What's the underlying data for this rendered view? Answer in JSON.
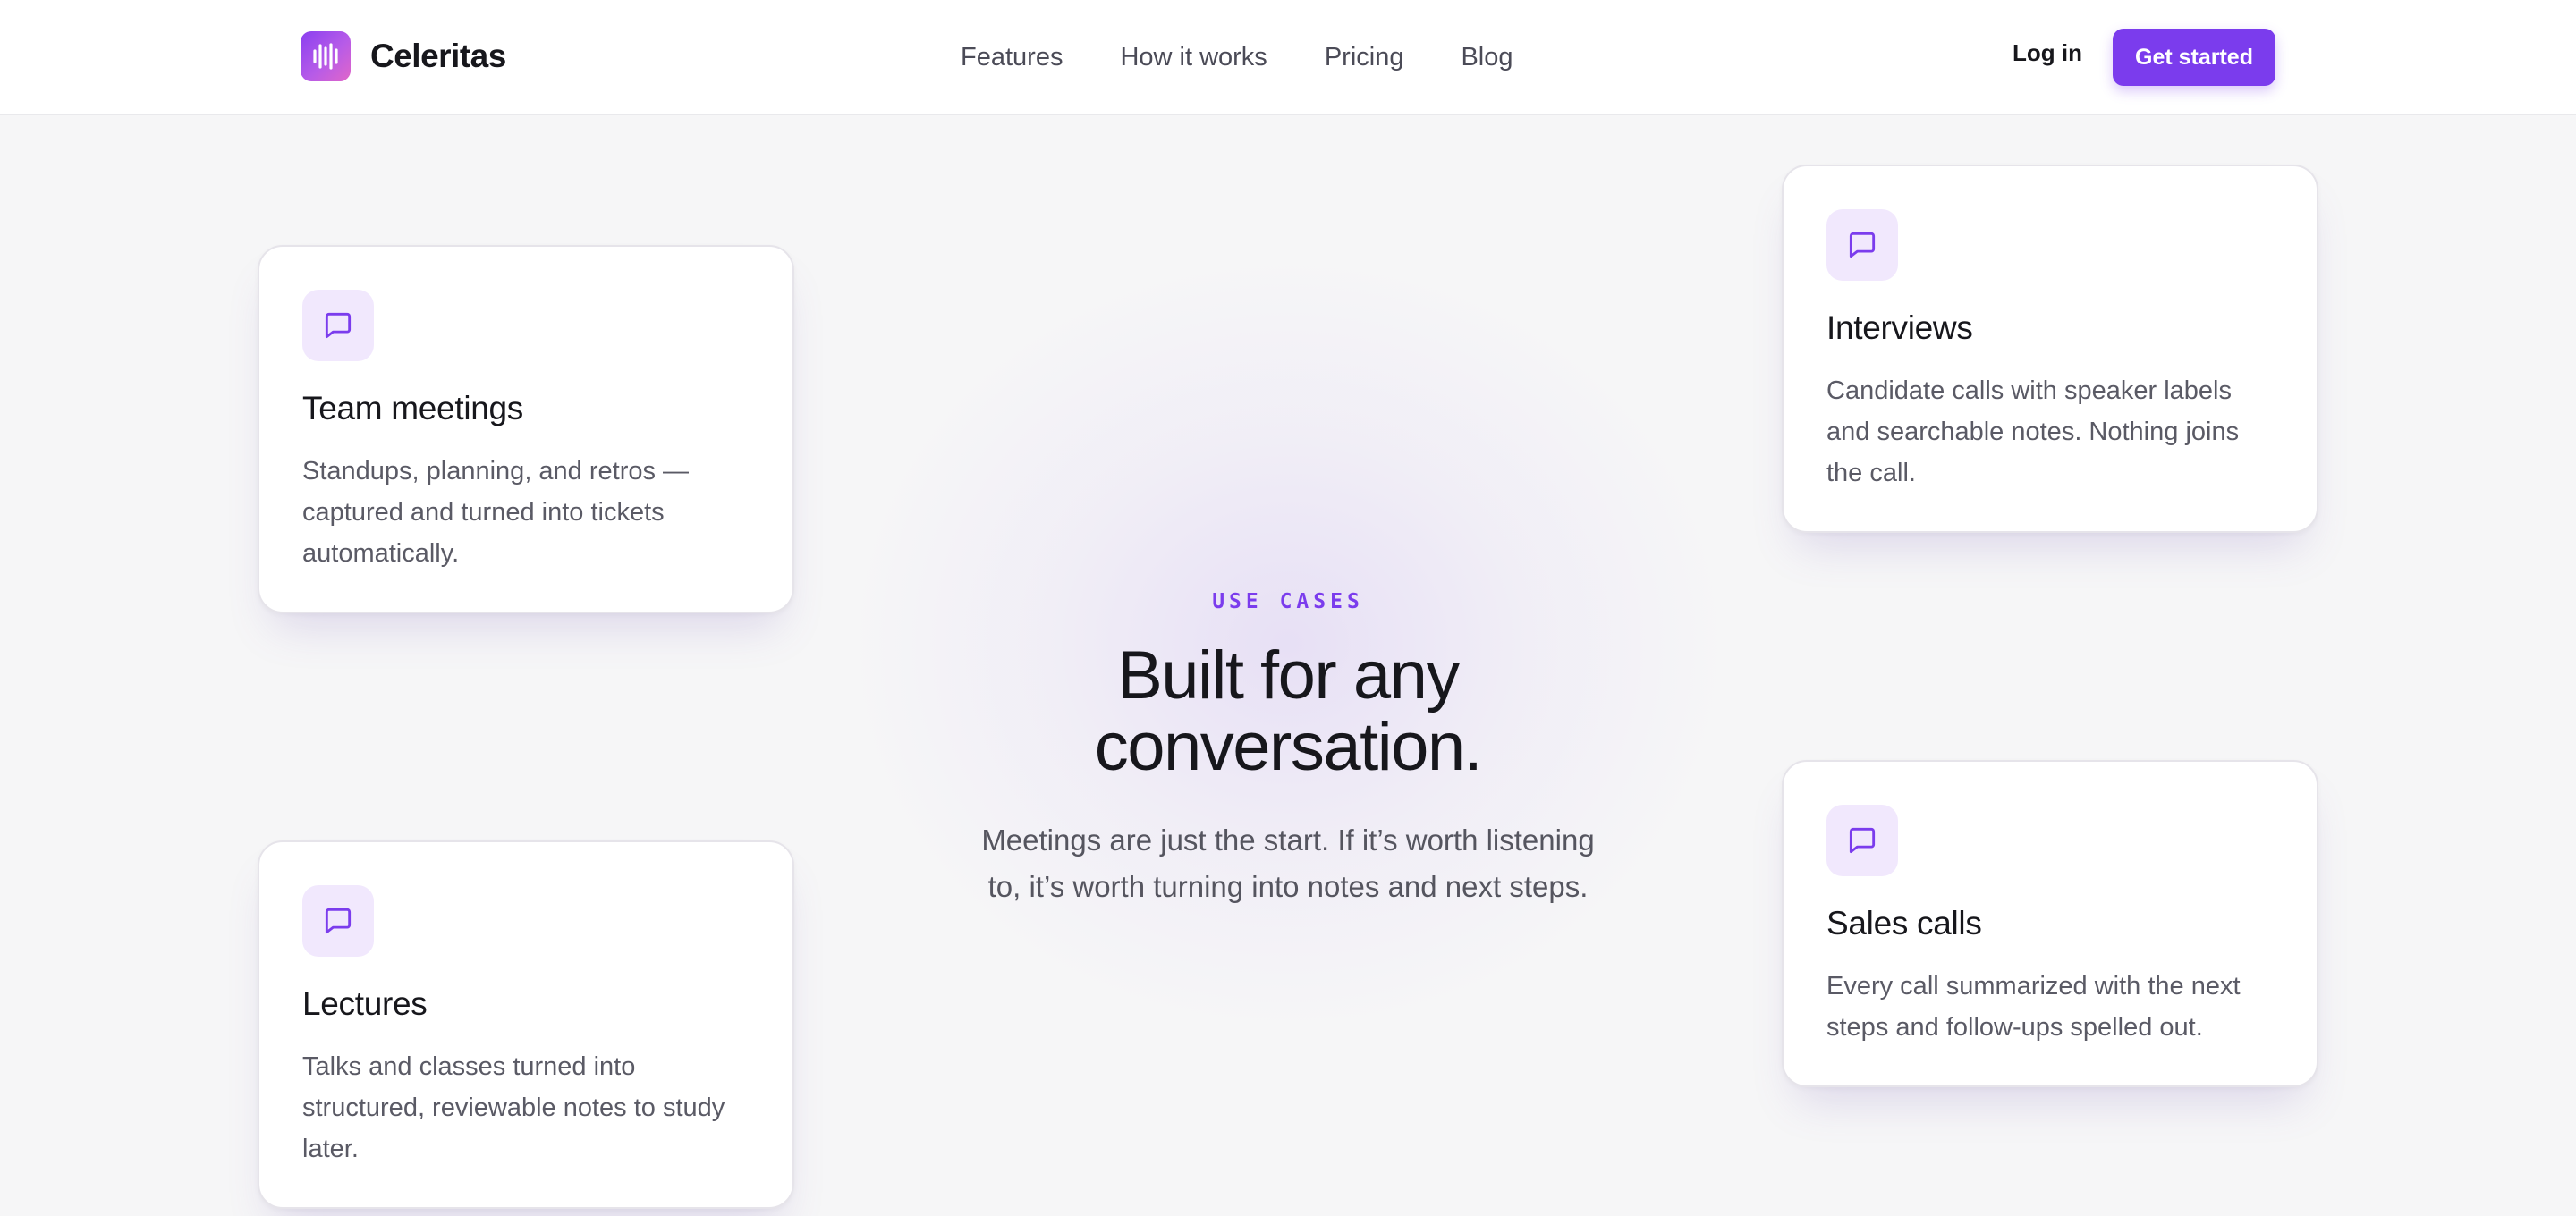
{
  "brand": {
    "name": "Celeritas",
    "logo_icon": "sound-wave-icon",
    "accent_color": "#7b3ced"
  },
  "nav": {
    "items": [
      {
        "label": "Features"
      },
      {
        "label": "How it works"
      },
      {
        "label": "Pricing"
      },
      {
        "label": "Blog"
      }
    ],
    "login_label": "Log in",
    "cta_label": "Get started"
  },
  "hero": {
    "eyebrow": "USE CASES",
    "headline_line1": "Built for any",
    "headline_line2": "conversation.",
    "subtitle": "Meetings are just the start. If it’s worth listening to, it’s worth turning into notes and next steps."
  },
  "cards": {
    "team": {
      "icon": "chat-bubble-icon",
      "title": "Team meetings",
      "text": "Standups, planning, and retros — captured and turned into tickets automatically."
    },
    "interviews": {
      "icon": "chat-bubble-icon",
      "title": "Interviews",
      "text": "Candidate calls with speaker labels and searchable notes. Nothing joins the call."
    },
    "lectures": {
      "icon": "chat-bubble-icon",
      "title": "Lectures",
      "text": "Talks and classes turned into structured, reviewable notes to study later."
    },
    "sales": {
      "icon": "chat-bubble-icon",
      "title": "Sales calls",
      "text": "Every call summarized with the next steps and follow-ups spelled out."
    }
  }
}
